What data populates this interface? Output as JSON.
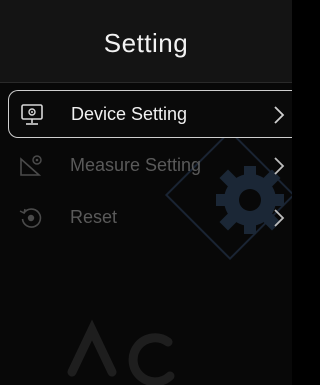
{
  "header": {
    "title": "Setting"
  },
  "menu": {
    "items": [
      {
        "label": "Device Setting",
        "icon": "monitor-icon",
        "selected": true
      },
      {
        "label": "Measure Setting",
        "icon": "measure-icon",
        "selected": false
      },
      {
        "label": "Reset",
        "icon": "reset-icon",
        "selected": false
      }
    ]
  },
  "colors": {
    "background": "#080808",
    "header": "#141414",
    "text_active": "#f0f0f0",
    "text_dim": "#5a5a5a",
    "selection_border": "#cfcfcf",
    "watermark": "#1e2a3a"
  }
}
